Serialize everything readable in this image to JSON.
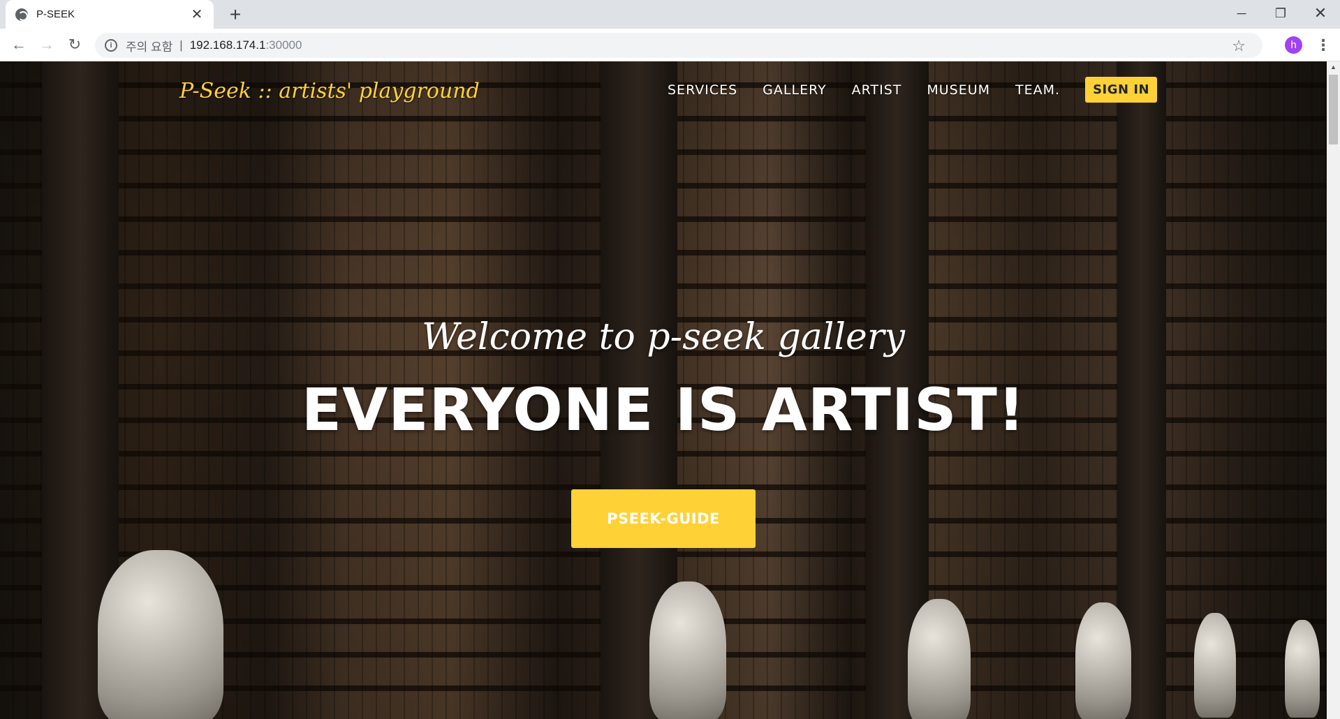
{
  "browser": {
    "tab_title": "P-SEEK",
    "close_glyph": "✕",
    "newtab_glyph": "+",
    "security_label": "주의 요함",
    "security_sep": "|",
    "url_host": "192.168.174.1",
    "url_port": ":30000",
    "profile_initial": "h",
    "back_glyph": "←",
    "forward_glyph": "→",
    "reload_glyph": "↻",
    "star_glyph": "☆",
    "menu_glyph": "⋮",
    "min_glyph": "─",
    "max_glyph": "❐",
    "winclose_glyph": "✕",
    "info_glyph": "i"
  },
  "site": {
    "brand": "P-Seek :: artists' playground",
    "nav": {
      "services": "SERVICES",
      "gallery": "GALLERY",
      "artist": "ARTIST",
      "museum": "MUSEUM",
      "team": "TEAM.",
      "signin": "SIGN IN"
    },
    "hero": {
      "lead": "Welcome to p-seek gallery",
      "heading": "EVERYONE IS ARTIST!",
      "button": "PSEEK-GUIDE"
    }
  },
  "colors": {
    "accent": "#fed136",
    "profile": "#a142f4"
  }
}
